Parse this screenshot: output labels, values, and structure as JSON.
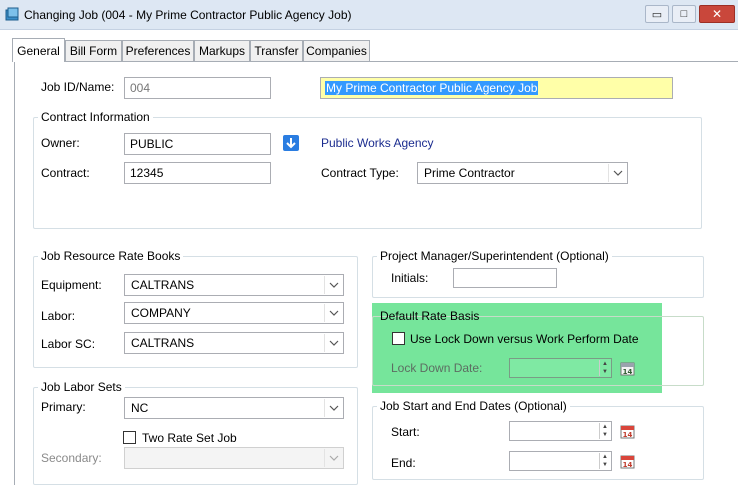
{
  "window": {
    "title": "Changing Job  (004 - My Prime Contractor Public Agency Job)",
    "controls": {
      "minimize": "▭",
      "restore": "□",
      "close": "✕"
    }
  },
  "tabs": [
    "General",
    "Bill Form",
    "Preferences",
    "Markups",
    "Transfer",
    "Companies"
  ],
  "general": {
    "job_id_label": "Job ID/Name:",
    "job_id_value": "004",
    "job_name_value": "My Prime Contractor Public Agency Job",
    "contract_info": {
      "legend": "Contract Information",
      "owner_label": "Owner:",
      "owner_value": "PUBLIC",
      "owner_name": "Public Works Agency",
      "contract_label": "Contract:",
      "contract_value": "12345",
      "contract_type_label": "Contract Type:",
      "contract_type_value": "Prime Contractor"
    },
    "rate_books": {
      "legend": "Job Resource Rate Books",
      "equipment_label": "Equipment:",
      "equipment_value": "CALTRANS",
      "labor_label": "Labor:",
      "labor_value": "COMPANY",
      "labor_sc_label": "Labor SC:",
      "labor_sc_value": "CALTRANS"
    },
    "labor_sets": {
      "legend": "Job Labor Sets",
      "primary_label": "Primary:",
      "primary_value": "NC",
      "two_rate_label": "Two Rate Set Job",
      "secondary_label": "Secondary:",
      "secondary_value": ""
    },
    "project_manager": {
      "legend": "Project Manager/Superintendent (Optional)",
      "initials_label": "Initials:",
      "initials_value": ""
    },
    "default_rate_basis": {
      "legend": "Default Rate Basis",
      "lockdown_checkbox_label": "Use Lock Down versus Work Perform Date",
      "lockdown_date_label": "Lock Down Date:",
      "lockdown_date_value": ""
    },
    "job_dates": {
      "legend": "Job Start and End Dates (Optional)",
      "start_label": "Start:",
      "start_value": "",
      "end_label": "End:",
      "end_value": ""
    },
    "colors": {
      "highlight": "#5ee08a",
      "selected_text_bg": "#3399ff",
      "job_name_field_bg": "#ffffa8",
      "link_blue": "#1b2c8f",
      "owner_lookup_button": "#2a7de1"
    }
  }
}
